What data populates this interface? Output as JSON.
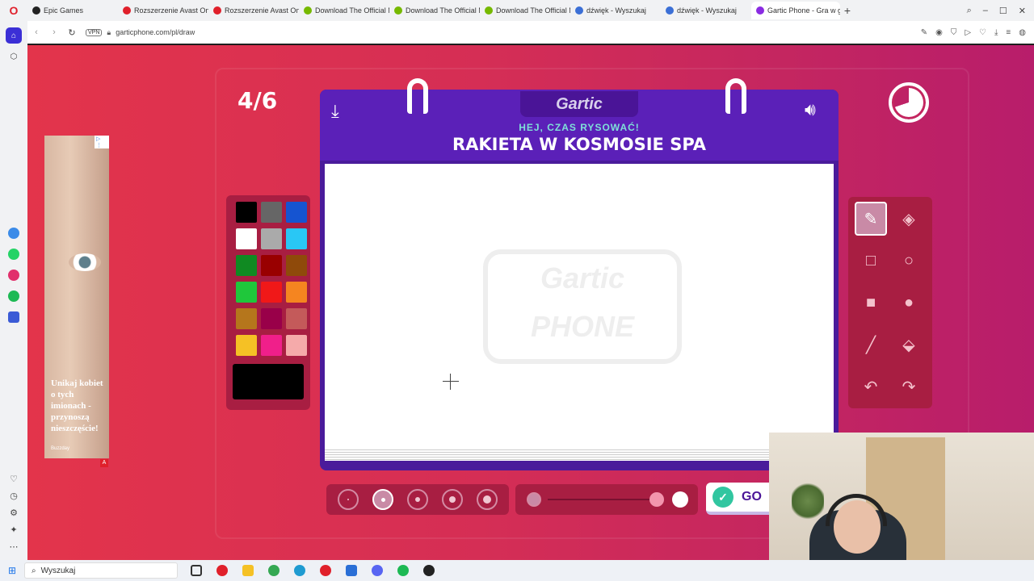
{
  "browser": {
    "tabs": [
      {
        "title": "Epic Games",
        "color": "#222222"
      },
      {
        "title": "Rozszerzenie Avast Online",
        "color": "#e0202b"
      },
      {
        "title": "Rozszerzenie Avast Online",
        "color": "#e0202b"
      },
      {
        "title": "Download The Official NV",
        "color": "#76b900"
      },
      {
        "title": "Download The Official NV",
        "color": "#76b900"
      },
      {
        "title": "Download The Official NV",
        "color": "#76b900"
      },
      {
        "title": "dźwięk - Wyszukaj",
        "color": "#3b6fd6"
      },
      {
        "title": "dźwięk - Wyszukaj",
        "color": "#3b6fd6"
      },
      {
        "title": "Gartic Phone - Gra w głu",
        "color": "#8a2be2"
      }
    ],
    "vpn": "VPN",
    "url": "garticphone.com/pl/draw"
  },
  "game": {
    "round": "4/6",
    "logo": "Gartic",
    "hint": "HEJ, CZAS RYSOWAĆ!",
    "phrase": "RAKIETA W KOSMOSIE SPA",
    "watermark": "Gartic PHONE",
    "go_label": "GO",
    "colors": [
      "#000000",
      "#666666",
      "#1554d1",
      "#ffffff",
      "#aaaaaa",
      "#29c7f5",
      "#108a22",
      "#990000",
      "#8f4a0a",
      "#1fc73b",
      "#f01818",
      "#f58520",
      "#b5761c",
      "#990049",
      "#c45a5a",
      "#f5c125",
      "#f01f8a",
      "#f5aaaa"
    ],
    "current_color": "#000000"
  },
  "ad": {
    "text": "Unikaj kobiet o tych imionach - przynoszą nieszczęście!",
    "sponsor": "Buzzday",
    "badge": "▷ ⋮",
    "marker": "A"
  },
  "taskbar": {
    "search_placeholder": "Wyszukaj"
  }
}
